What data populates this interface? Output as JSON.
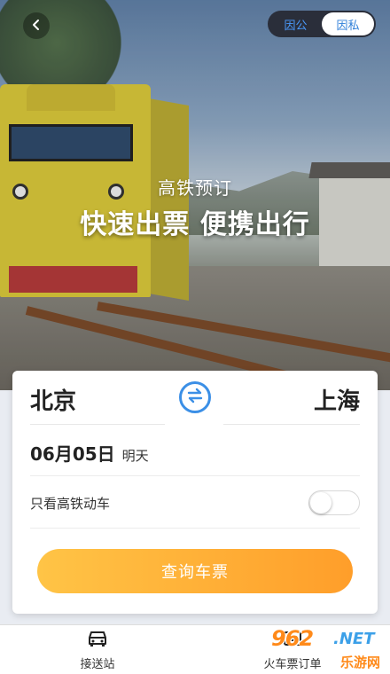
{
  "header": {
    "back_icon": "chevron-left-icon",
    "mode_toggle": {
      "options": [
        "因公",
        "因私"
      ],
      "selected": "因私"
    }
  },
  "hero": {
    "subtitle": "高铁预订",
    "title": "快速出票 便携出行"
  },
  "booking": {
    "from_city": "北京",
    "to_city": "上海",
    "swap_icon": "swap-arrows-icon",
    "date": "06月05日",
    "date_hint": "明天",
    "filter_label": "只看高铁动车",
    "filter_on": false,
    "search_label": "查询车票",
    "accent_color": "#3b8fe6",
    "button_gradient": [
      "#ffc446",
      "#ff9e2a"
    ]
  },
  "bottom_nav": {
    "items": [
      {
        "label": "接送站",
        "icon": "car-icon"
      },
      {
        "label": "火车票订单",
        "icon": "ticket-icon"
      }
    ]
  },
  "watermark": {
    "number": "962",
    "domain": ".NET",
    "cn": "乐游网"
  }
}
